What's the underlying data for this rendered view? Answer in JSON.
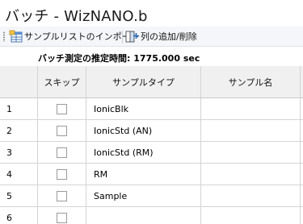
{
  "window": {
    "title": "バッチ - WizNANO.b"
  },
  "toolbar": {
    "import_label": "サンプルリストのインポート",
    "add_remove_columns_label": "列の追加/削除"
  },
  "info": {
    "text": "バッチ測定の推定時間:  1775.000 sec"
  },
  "table": {
    "headers": [
      "",
      "スキップ",
      "サンプルタイプ",
      "サンプル名"
    ],
    "rows": [
      {
        "num": "1",
        "skip": false,
        "type": "IonicBlk",
        "name": ""
      },
      {
        "num": "2",
        "skip": false,
        "type": "IonicStd (AN)",
        "name": ""
      },
      {
        "num": "3",
        "skip": false,
        "type": "IonicStd (RM)",
        "name": ""
      },
      {
        "num": "4",
        "skip": false,
        "type": "RM",
        "name": ""
      },
      {
        "num": "5",
        "skip": false,
        "type": "Sample",
        "name": ""
      },
      {
        "num": "6",
        "skip": false,
        "type": "",
        "name": ""
      }
    ]
  },
  "colors": {
    "header_bg": "#f0f0f0",
    "toolbar_bg": "#f4f6f9",
    "grid_line": "#d4d4d4"
  }
}
